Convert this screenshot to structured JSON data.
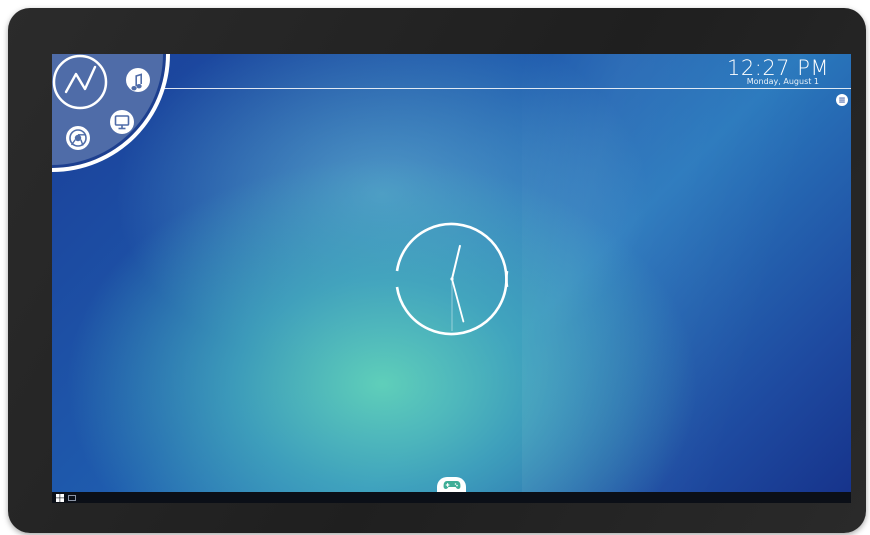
{
  "status_bar": {
    "time": "12:27 PM",
    "date": "Monday, August 1"
  },
  "launcher": {
    "main_icon": "activity-graph-icon",
    "apps": [
      {
        "icon": "music-note-icon"
      },
      {
        "icon": "monitor-icon"
      },
      {
        "icon": "chrome-icon"
      }
    ]
  },
  "menu_icon": "list-menu-icon",
  "dock_icon": "gamepad-icon",
  "taskbar": {
    "start_icon": "windows-logo-icon",
    "task_view_icon": "task-view-icon"
  },
  "colors": {
    "bezel": "#232323",
    "screen_blue": "#1f5cae",
    "screen_teal": "#62d4ba",
    "launcher_fill": "#4d6aa6",
    "taskbar": "#0b0f17",
    "foreground": "#ffffff"
  },
  "analog_clock": {
    "hour": 12,
    "minute": 27,
    "second": 30
  }
}
